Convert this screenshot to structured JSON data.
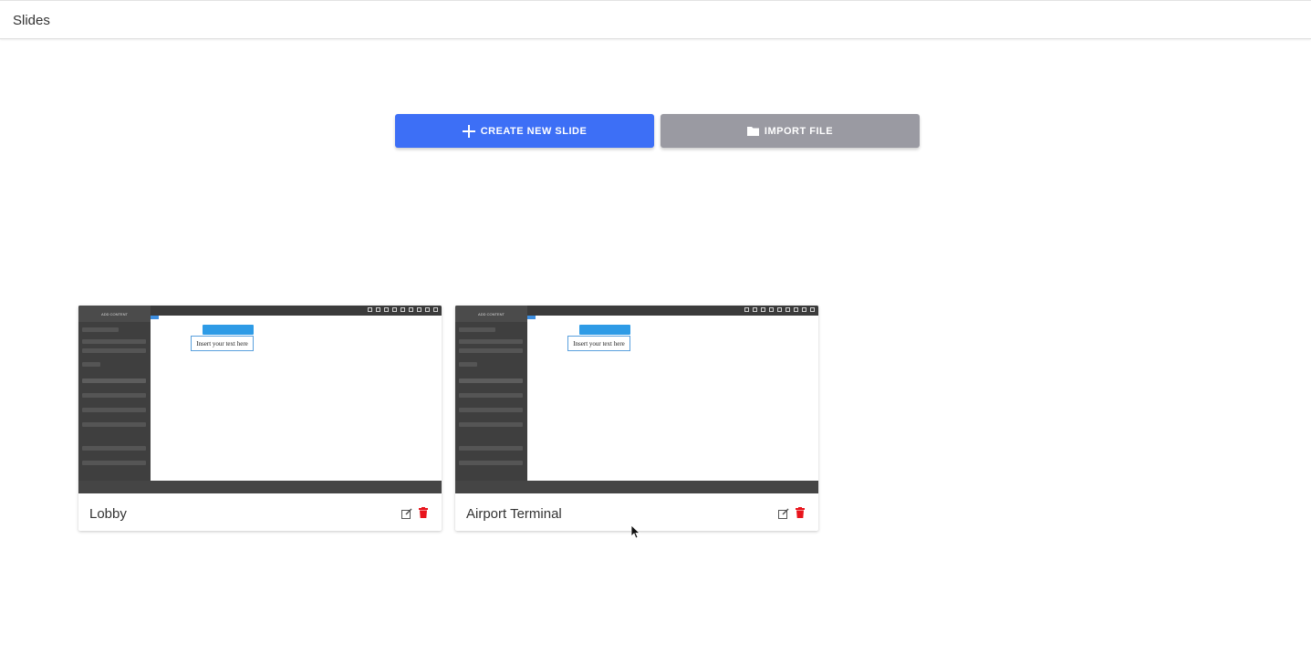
{
  "header": {
    "title": "Slides"
  },
  "actions": {
    "create_label": "CREATE NEW SLIDE",
    "import_label": "IMPORT FILE"
  },
  "colors": {
    "primary": "#3d6ff6",
    "secondary": "#9a9aa2",
    "delete": "#e8141c"
  },
  "slides": [
    {
      "name": "Lobby",
      "thumbnail_text": "Insert your text here",
      "thumbnail_add_content": "ADD CONTENT"
    },
    {
      "name": "Airport Terminal",
      "thumbnail_text": "Insert your text here",
      "thumbnail_add_content": "ADD CONTENT"
    }
  ],
  "icons": [
    "plus-icon",
    "folder-icon",
    "edit-icon",
    "trash-icon",
    "mouse-cursor-icon"
  ]
}
